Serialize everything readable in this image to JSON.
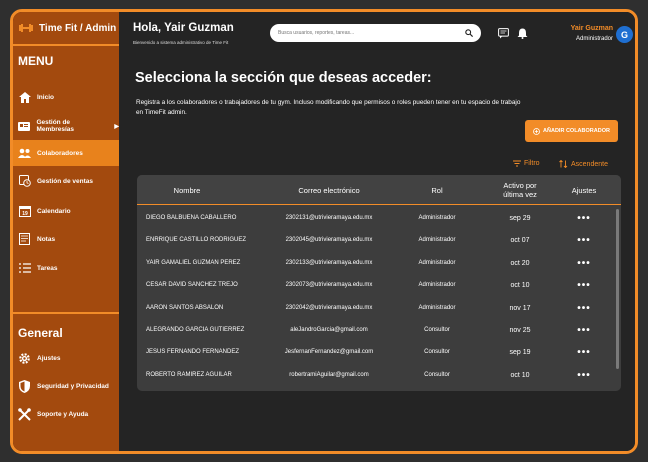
{
  "brand": {
    "name": "Time Fit / Admin"
  },
  "sidebar": {
    "menu_title": "MENU",
    "items": [
      {
        "label": "Inicio",
        "icon": "home-icon"
      },
      {
        "label": "Gestión de Membresías",
        "icon": "membership-card-icon"
      },
      {
        "label": "Colaboradores",
        "icon": "users-icon",
        "active": true
      },
      {
        "label": "Gestión de ventas",
        "icon": "sales-icon"
      },
      {
        "label": "Calendario",
        "icon": "calendar-icon"
      },
      {
        "label": "Notas",
        "icon": "notes-icon"
      },
      {
        "label": "Tareas",
        "icon": "tasks-icon"
      }
    ],
    "general_title": "General",
    "general_items": [
      {
        "label": "Ajustes",
        "icon": "gear-icon"
      },
      {
        "label": "Seguridad y Privacidad",
        "icon": "shield-icon"
      },
      {
        "label": "Soporte y Ayuda",
        "icon": "tools-icon"
      }
    ]
  },
  "topbar": {
    "greeting": "Hola, Yair Guzman",
    "subtitle": "Bienvenido a sistema administrativo de Time Fit",
    "search_placeholder": "Busca usuarios, reportes, tareas...",
    "user_name": "Yair Guzman",
    "user_role": "Administrador",
    "avatar_letter": "G"
  },
  "main": {
    "title": "Selecciona la sección que deseas acceder:",
    "description": "Registra a los colaboradores o trabajadores de tu gym. Incluso modificando que permisos o roles pueden tener en tu espacio de trabajo en TimeFit admin.",
    "add_button": "AÑADIR COLABORADOR",
    "filter_label": "Filtro",
    "sort_label": "Ascendente"
  },
  "table": {
    "headers": [
      "Nombre",
      "Correo electrónico",
      "Rol",
      "Activo por\núltima vez",
      "Ajustes"
    ],
    "rows": [
      {
        "name": "DIEGO BALBUENA CABALLERO",
        "email": "2302131@utrivieramaya.edu.mx",
        "role": "Administrador",
        "date": "sep 29"
      },
      {
        "name": "ENRRIQUE CASTILLO RODRIGUEZ",
        "email": "2302045@utrivieramaya.edu.mx",
        "role": "Administrador",
        "date": "oct 07"
      },
      {
        "name": "YAIR GAMALIEL GUZMAN PEREZ",
        "email": "2302133@utrivieramaya.edu.mx",
        "role": "Administrador",
        "date": "oct 20"
      },
      {
        "name": "CESAR DAVID SANCHEZ TREJO",
        "email": "2302073@utrivieramaya.edu.mx",
        "role": "Administrador",
        "date": "oct 10"
      },
      {
        "name": "AARON SANTOS ABSALON",
        "email": "2302042@utrivieramaya.edu.mx",
        "role": "Administrador",
        "date": "nov 17"
      },
      {
        "name": "ALEGRANDO GARCIA GUTIERREZ",
        "email": "aleJandroGarcia@gmail.com",
        "role": "Consultor",
        "date": "nov 25"
      },
      {
        "name": "JESUS FERNANDO FERNANDEZ",
        "email": "JesfernanFernandez@gmail.com",
        "role": "Consultor",
        "date": "sep 19"
      },
      {
        "name": "ROBERTO RAMIREZ AGUILAR",
        "email": "robertramiAguilar@gmail.com",
        "role": "Consultor",
        "date": "oct 10"
      }
    ],
    "actions_glyph": "•••"
  },
  "colors": {
    "accent": "#f28c28",
    "sidebar": "#a34a0e",
    "background": "#242424",
    "table": "#3d3d3d"
  }
}
